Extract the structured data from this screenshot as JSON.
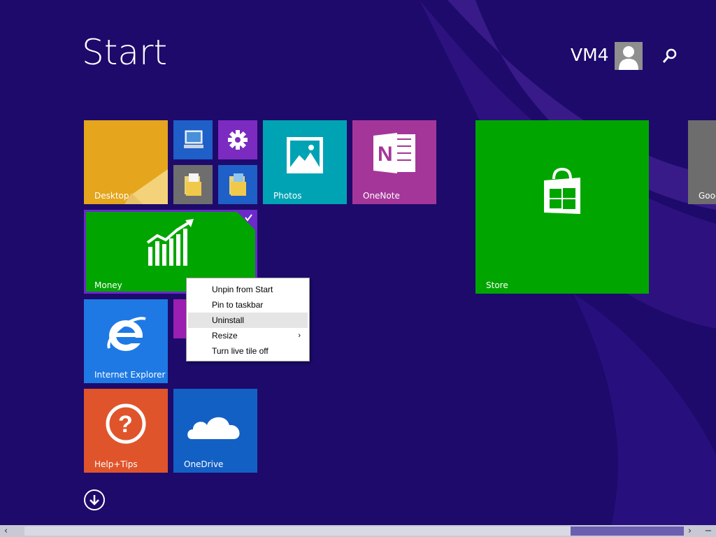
{
  "header": {
    "title": "Start",
    "user_name": "VM4"
  },
  "tiles": {
    "desktop": "Desktop",
    "photos": "Photos",
    "onenote": "OneNote",
    "store": "Store",
    "google": "Goog",
    "money": "Money",
    "internet_explorer": "Internet Explorer",
    "help_tips": "Help+Tips",
    "onedrive": "OneDrive"
  },
  "context_menu": {
    "items": [
      {
        "label": "Unpin from Start"
      },
      {
        "label": "Pin to taskbar"
      },
      {
        "label": "Uninstall"
      },
      {
        "label": "Resize"
      },
      {
        "label": "Turn live tile off"
      }
    ]
  },
  "colors": {
    "background": "#1d0a6b",
    "desktop_tile": "#e5a51c",
    "photos_tile": "#00a3b4",
    "onenote_tile": "#a53699",
    "store_tile": "#00a500",
    "money_tile": "#00a500",
    "ie_tile": "#1e79e4",
    "help_tile": "#e0542b",
    "onedrive_tile": "#1360c4"
  }
}
